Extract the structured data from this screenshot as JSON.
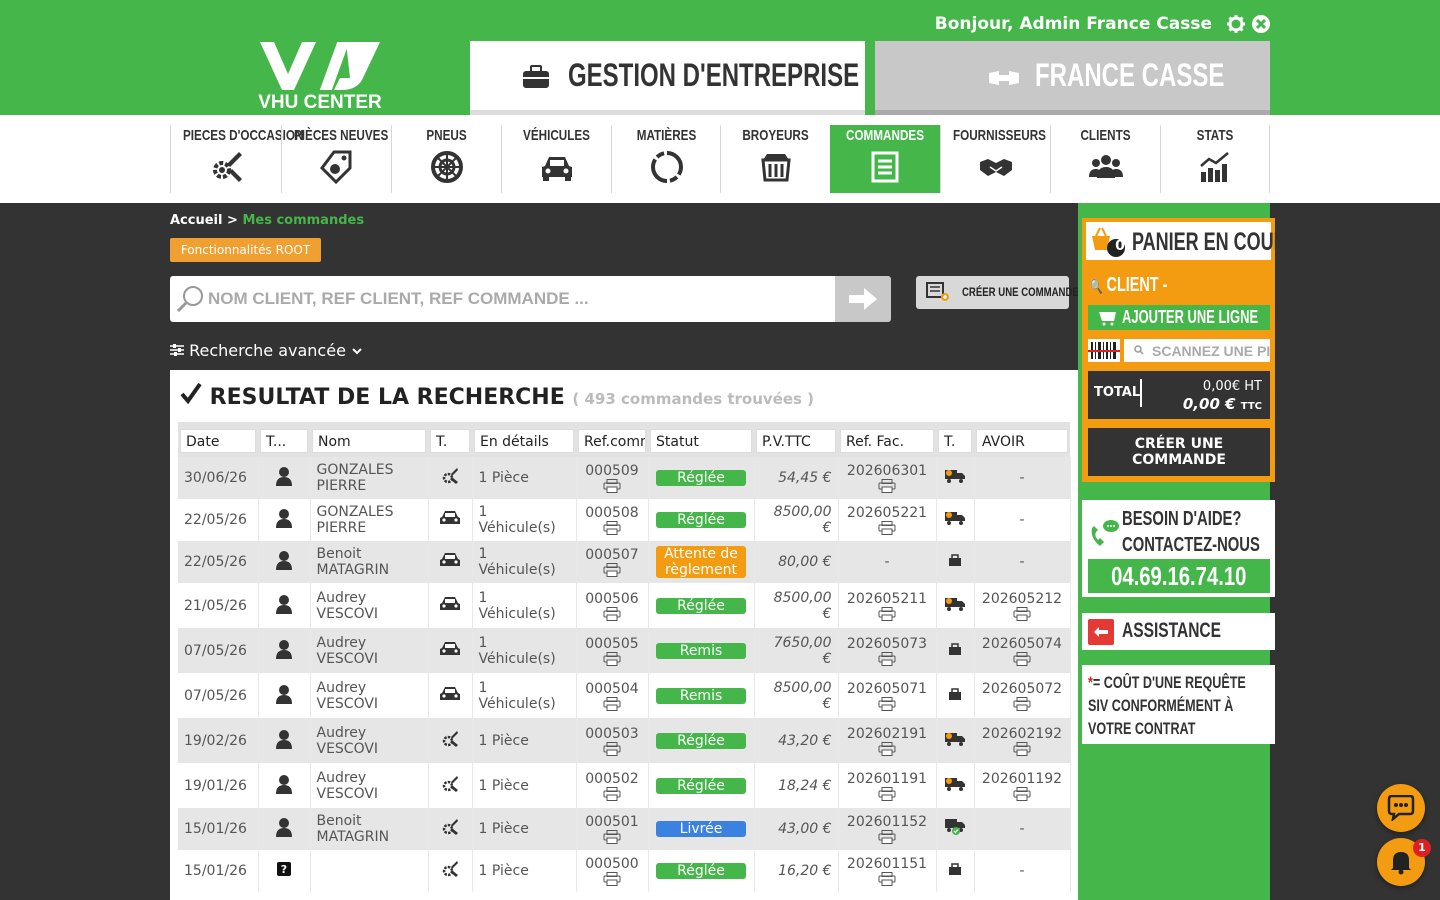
{
  "header": {
    "greeting": "Bonjour, Admin France Casse",
    "logo_text": "VHU CENTER",
    "tab_gestion": "GESTION D'ENTREPRISE",
    "tab_france": "FRANCE CASSE"
  },
  "nav": [
    {
      "label": "PIECES D'OCCASION",
      "icon": "gear-wrench-icon"
    },
    {
      "label": "PIÈCES NEUVES",
      "icon": "tag-gears-icon"
    },
    {
      "label": "PNEUS",
      "icon": "tire-icon"
    },
    {
      "label": "VÉHICULES",
      "icon": "car-icon"
    },
    {
      "label": "MATIÈRES",
      "icon": "recycle-icon"
    },
    {
      "label": "BROYEURS",
      "icon": "shredder-icon"
    },
    {
      "label": "COMMANDES",
      "icon": "order-list-icon",
      "active": true
    },
    {
      "label": "FOURNISSEURS",
      "icon": "handshake-icon"
    },
    {
      "label": "CLIENTS",
      "icon": "users-icon"
    },
    {
      "label": "STATS",
      "icon": "chart-icon"
    }
  ],
  "breadcrumb": {
    "home": "Accueil",
    "sep": ">",
    "current": "Mes commandes"
  },
  "root_button": "Fonctionnalités ROOT",
  "search": {
    "placeholder": "NOM CLIENT, REF CLIENT, REF COMMANDE ..."
  },
  "create_order_label": "CRÉER UNE COMMANDE",
  "advanced_search": "Recherche avancée",
  "results": {
    "title": "RESULTAT DE LA RECHERCHE",
    "count": "( 493 commandes trouvées )",
    "columns": [
      "Date",
      "T...",
      "Nom",
      "T.",
      "En détails",
      "Ref.comm",
      "Statut",
      "P.V.TTC",
      "Ref. Fac.",
      "T.",
      "AVOIR"
    ],
    "rows": [
      {
        "date": "30/06/26",
        "client_type": "person",
        "name1": "GONZALES",
        "name2": "PIERRE",
        "item_type": "part",
        "details1": "1 Pièce",
        "details2": "",
        "ref": "000509",
        "status": "Réglée",
        "status_color": "green",
        "price1": "54,45 €",
        "price2": "",
        "invoice": "202606301",
        "transport": "truck",
        "avoir": "-"
      },
      {
        "date": "22/05/26",
        "client_type": "person",
        "name1": "GONZALES",
        "name2": "PIERRE",
        "item_type": "car",
        "details1": "1",
        "details2": "Véhicule(s)",
        "ref": "000508",
        "status": "Réglée",
        "status_color": "green",
        "price1": "8500,00",
        "price2": "€",
        "invoice": "202605221",
        "transport": "truck",
        "avoir": "-"
      },
      {
        "date": "22/05/26",
        "client_type": "person",
        "name1": "Benoit",
        "name2": "MATAGRIN",
        "item_type": "car",
        "details1": "1",
        "details2": "Véhicule(s)",
        "ref": "000507",
        "status": "Attente de règlement",
        "status_color": "orange",
        "price1": "80,00 €",
        "price2": "",
        "invoice": "-",
        "transport": "shop",
        "avoir": "-"
      },
      {
        "date": "21/05/26",
        "client_type": "person",
        "name1": "Audrey",
        "name2": "VESCOVI",
        "item_type": "car",
        "details1": "1",
        "details2": "Véhicule(s)",
        "ref": "000506",
        "status": "Réglée",
        "status_color": "green",
        "price1": "8500,00",
        "price2": "€",
        "invoice": "202605211",
        "transport": "truck",
        "avoir": "202605212"
      },
      {
        "date": "07/05/26",
        "client_type": "person",
        "name1": "Audrey",
        "name2": "VESCOVI",
        "item_type": "car",
        "details1": "1",
        "details2": "Véhicule(s)",
        "ref": "000505",
        "status": "Remis",
        "status_color": "green",
        "price1": "7650,00",
        "price2": "€",
        "invoice": "202605073",
        "transport": "shop",
        "avoir": "202605074"
      },
      {
        "date": "07/05/26",
        "client_type": "person",
        "name1": "Audrey",
        "name2": "VESCOVI",
        "item_type": "car",
        "details1": "1",
        "details2": "Véhicule(s)",
        "ref": "000504",
        "status": "Remis",
        "status_color": "green",
        "price1": "8500,00",
        "price2": "€",
        "invoice": "202605071",
        "transport": "shop",
        "avoir": "202605072"
      },
      {
        "date": "19/02/26",
        "client_type": "person",
        "name1": "Audrey",
        "name2": "VESCOVI",
        "item_type": "part",
        "details1": "1 Pièce",
        "details2": "",
        "ref": "000503",
        "status": "Réglée",
        "status_color": "green",
        "price1": "43,20 €",
        "price2": "",
        "invoice": "202602191",
        "transport": "truck",
        "avoir": "202602192"
      },
      {
        "date": "19/01/26",
        "client_type": "person",
        "name1": "Audrey",
        "name2": "VESCOVI",
        "item_type": "part",
        "details1": "1 Pièce",
        "details2": "",
        "ref": "000502",
        "status": "Réglée",
        "status_color": "green",
        "price1": "18,24 €",
        "price2": "",
        "invoice": "202601191",
        "transport": "truck",
        "avoir": "202601192"
      },
      {
        "date": "15/01/26",
        "client_type": "person",
        "name1": "Benoit",
        "name2": "MATAGRIN",
        "item_type": "part",
        "details1": "1 Pièce",
        "details2": "",
        "ref": "000501",
        "status": "Livrée",
        "status_color": "blue",
        "price1": "43,00 €",
        "price2": "",
        "invoice": "202601152",
        "transport": "delivered",
        "avoir": "-"
      },
      {
        "date": "15/01/26",
        "client_type": "unknown",
        "name1": "",
        "name2": "",
        "item_type": "part",
        "details1": "1 Pièce",
        "details2": "",
        "ref": "000500",
        "status": "Réglée",
        "status_color": "green",
        "price1": "16,20 €",
        "price2": "",
        "invoice": "202601151",
        "transport": "shop",
        "avoir": "-"
      }
    ]
  },
  "panier": {
    "count": "0",
    "title": "PANIER EN COURS",
    "client_label": "CLIENT -",
    "add_line": "AJOUTER UNE LIGNE",
    "scan_placeholder": "SCANNEZ UNE PIECE",
    "total_label": "TOTAL",
    "total_ht": "0,00€ HT",
    "total_ttc": "0,00 €",
    "ttc_suffix": "TTC",
    "create_line1": "CRÉER UNE",
    "create_line2": "COMMANDE"
  },
  "help": {
    "line1": "BESOIN D'AIDE?",
    "line2": "CONTACTEZ-NOUS",
    "phone": "04.69.16.74.10"
  },
  "assistance": "ASSISTANCE",
  "note": {
    "star": "*",
    "text": "= COÛT D'UNE REQUÊTE SIV CONFORMÉMENT À VOTRE CONTRAT"
  },
  "notifications": {
    "count": "1"
  },
  "colors": {
    "green": "#45b649",
    "orange": "#f39c12",
    "dark": "#333333",
    "blue": "#3b82e0"
  }
}
